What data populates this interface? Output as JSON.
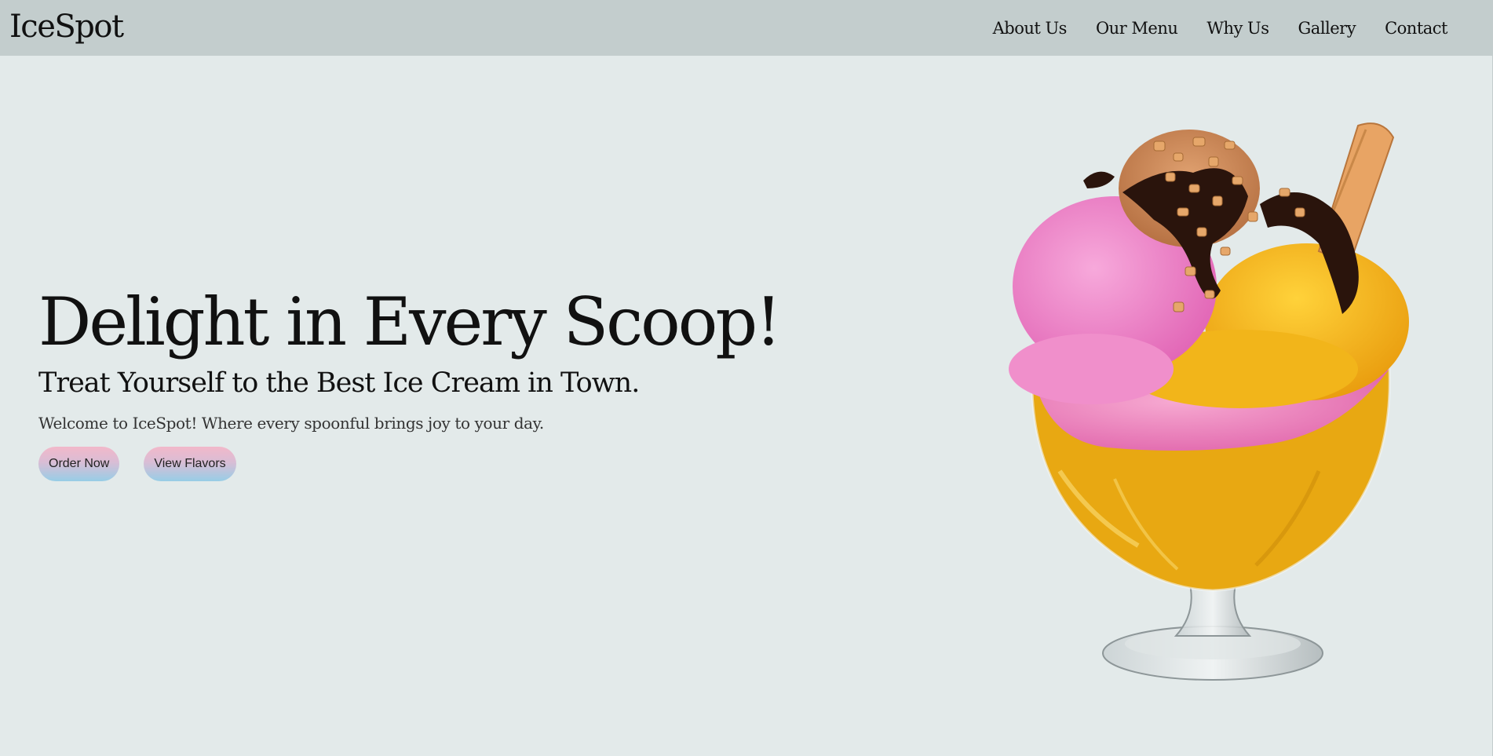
{
  "brand": {
    "logo_text": "IceSpot"
  },
  "nav": {
    "items": [
      {
        "label": "About Us"
      },
      {
        "label": "Our Menu"
      },
      {
        "label": "Why Us"
      },
      {
        "label": "Gallery"
      },
      {
        "label": "Contact"
      }
    ]
  },
  "hero": {
    "title": "Delight in Every Scoop!",
    "subtitle": "Treat Yourself to the Best Ice Cream in Town.",
    "description": "Welcome to IceSpot! Where every spoonful brings joy to your day.",
    "buttons": {
      "order_label": "Order Now",
      "flavors_label": "View Flavors"
    },
    "image_subject": "ice-cream-sundae"
  },
  "colors": {
    "page_background": "#e3eaea",
    "navbar_background": "#c3cdcd",
    "button_gradient_top": "#f2b8c9",
    "button_gradient_bottom": "#97cde6",
    "scoop_pink": "#ef7fc4",
    "scoop_yellow": "#f4b81c",
    "chocolate_sauce": "#2a140c"
  }
}
